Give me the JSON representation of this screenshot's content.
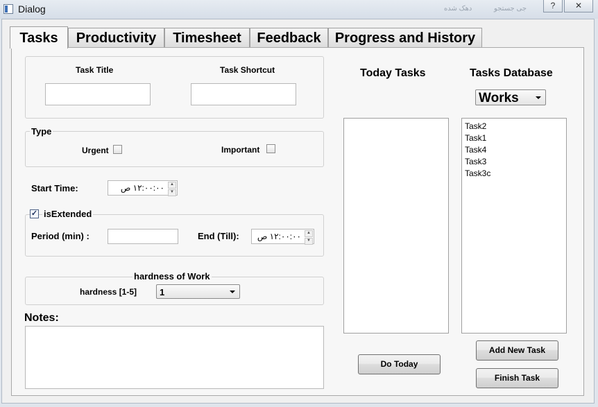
{
  "window": {
    "title": "Dialog",
    "help_glyph": "?",
    "close_glyph": "✕",
    "blurred_left": "دهک شده",
    "blurred_right": "جی جستجو"
  },
  "tabs": [
    "Tasks",
    "Productivity",
    "Timesheet",
    "Feedback",
    "Progress and History"
  ],
  "form": {
    "task_title_label": "Task Title",
    "task_title_value": "",
    "task_shortcut_label": "Task Shortcut",
    "task_shortcut_value": "",
    "type_label": "Type",
    "urgent_label": "Urgent",
    "urgent_checked": false,
    "important_label": "Important",
    "important_checked": false,
    "start_time_label": "Start Time:",
    "start_time_value": "۱۲:۰۰:۰۰ ص",
    "is_extended_label": "isExtended",
    "is_extended_checked": true,
    "period_label": "Period (min) :",
    "period_value": "",
    "end_label": "End (Till):",
    "end_value": "۱۲:۰۰:۰۰ ص",
    "hardness_group_label": "hardness of Work",
    "hardness_label": "hardness [1-5]",
    "hardness_value": "1",
    "notes_label": "Notes:",
    "notes_value": ""
  },
  "today": {
    "heading": "Today Tasks",
    "items": [],
    "do_today_label": "Do Today"
  },
  "database": {
    "heading": "Tasks Database",
    "category": "Works",
    "items": [
      "Task2",
      "Task1",
      "Task4",
      "Task3",
      "Task3c"
    ],
    "add_label": "Add New Task",
    "finish_label": "Finish Task"
  },
  "icons": {
    "spin_up": "▲",
    "spin_down": "▼",
    "check": "✓"
  }
}
